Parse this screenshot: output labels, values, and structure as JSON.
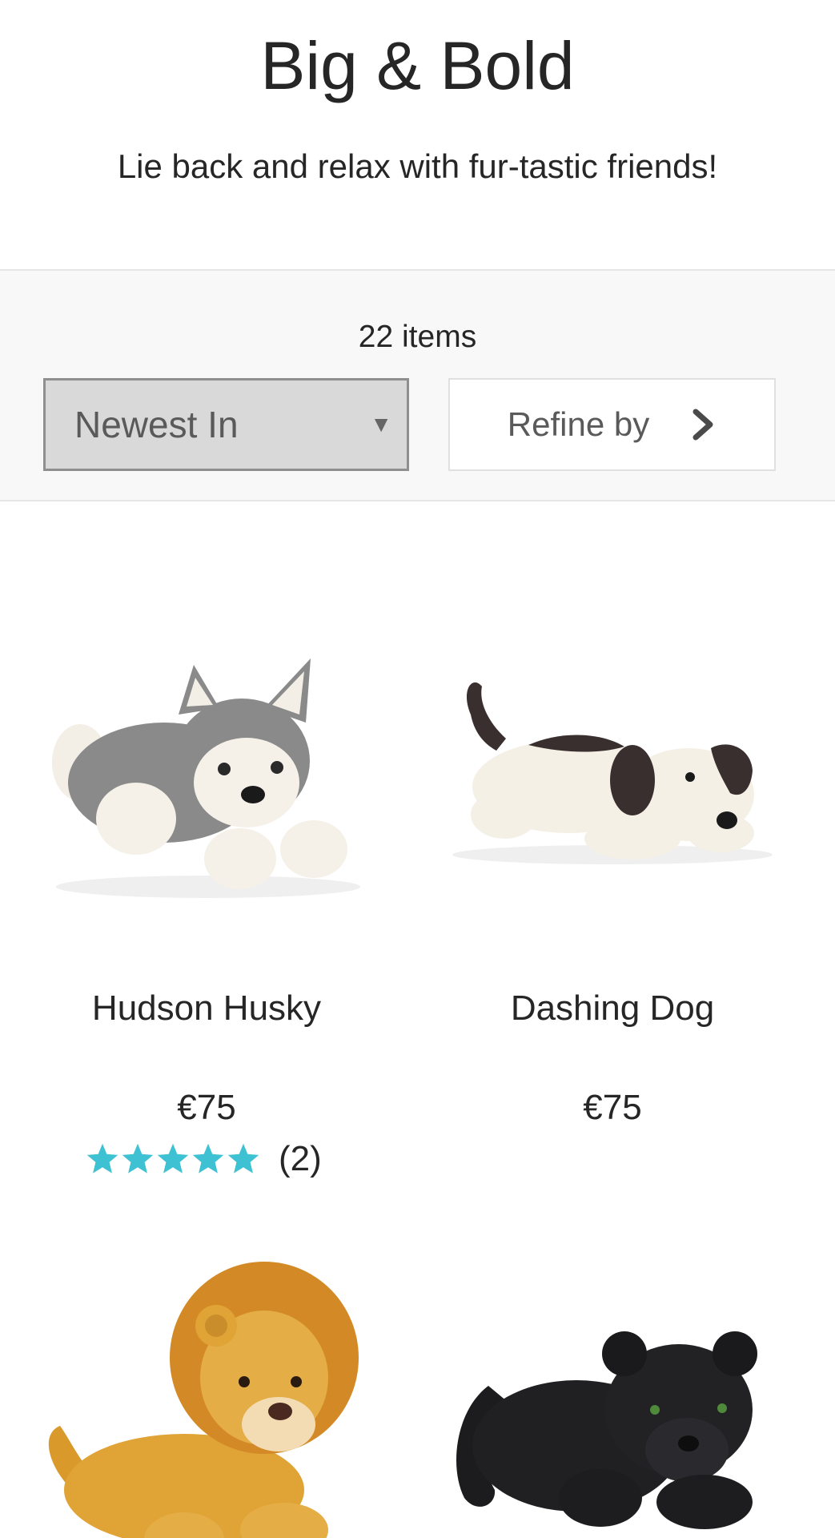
{
  "header": {
    "title": "Big & Bold",
    "subtitle": "Lie back and relax with fur-tastic friends!"
  },
  "filters": {
    "item_count": "22 items",
    "sort_selected": "Newest In",
    "refine_label": "Refine by"
  },
  "colors": {
    "star": "#3ec1d3",
    "sort_bg": "#d9d9d9",
    "bar_bg": "#f8f8f8"
  },
  "products": [
    {
      "name": "Hudson Husky",
      "price": "€75",
      "rating_stars": 5,
      "review_count": "(2)",
      "image_icon": "husky-plush-image"
    },
    {
      "name": "Dashing Dog",
      "price": "€75",
      "image_icon": "dog-plush-image"
    },
    {
      "image_icon": "lion-plush-image"
    },
    {
      "image_icon": "panther-plush-image"
    }
  ]
}
